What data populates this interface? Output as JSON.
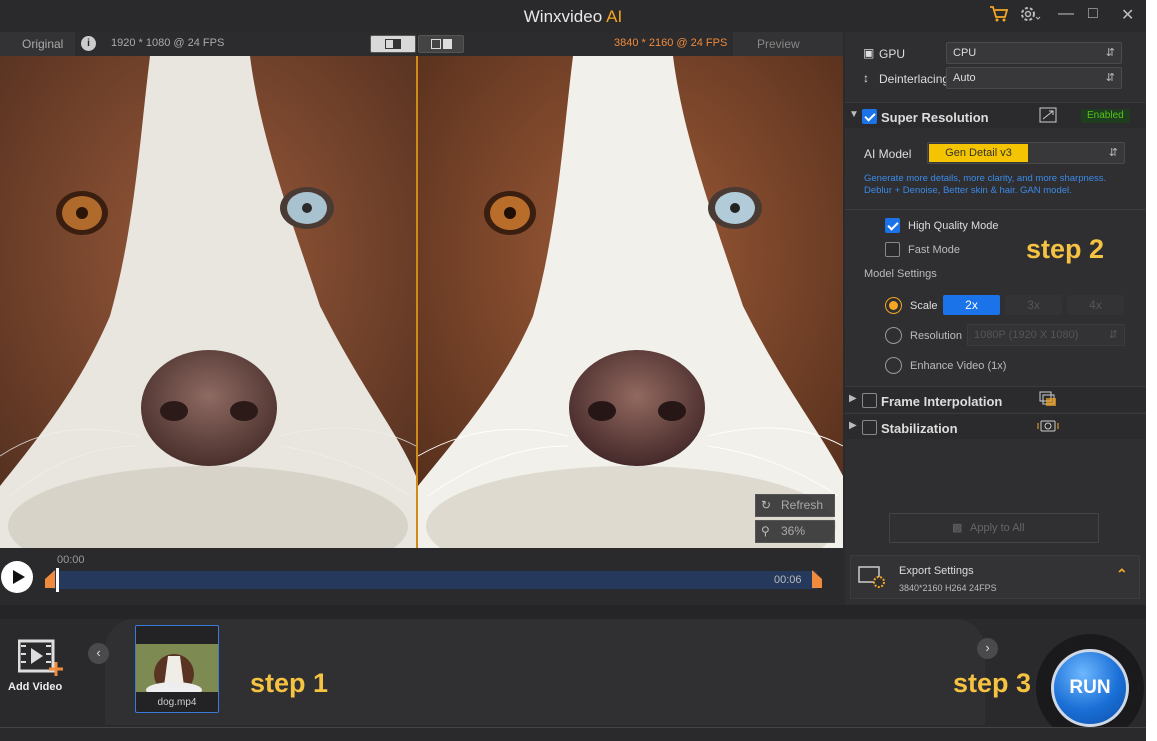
{
  "app": {
    "title": "Winxvideo",
    "title_ai": "AI",
    "colors": {
      "accent": "#f5a623",
      "blue": "#1a73e8",
      "enabled": "#52c41a"
    }
  },
  "titlebar": {
    "icons": [
      "cart-icon",
      "gear-icon",
      "minimize-icon",
      "maximize-icon",
      "close-icon"
    ]
  },
  "viewer": {
    "original_label": "Original",
    "info_icon": "i",
    "original_spec": "1920 * 1080 @ 24 FPS",
    "preview_spec": "3840 * 2160 @ 24 FPS",
    "preview_label": "Preview",
    "refresh": "Refresh",
    "zoom": "36%"
  },
  "timeline": {
    "current": "00:00",
    "end": "00:06"
  },
  "panel": {
    "gpu_label": "GPU",
    "gpu_value": "CPU",
    "deint_label": "Deinterlacing",
    "deint_value": "Auto",
    "super_res": {
      "label": "Super Resolution",
      "badge": "Enabled",
      "checked": true
    },
    "ai_model_label": "AI Model",
    "ai_model_value": "Gen Detail v3",
    "ai_desc1": "Generate more details, more clarity, and more sharpness.",
    "ai_desc2": "Deblur + Denoise, Better skin & hair. GAN model.",
    "hq_mode": "High Quality Mode",
    "fast_mode": "Fast Mode",
    "model_settings": "Model Settings",
    "scale_label": "Scale",
    "scale_opts": [
      "2x",
      "3x",
      "4x"
    ],
    "resolution_label": "Resolution",
    "resolution_value": "1080P (1920 X 1080)",
    "enhance_label": "Enhance Video (1x)",
    "frame_interp": "Frame Interpolation",
    "stabilization": "Stabilization",
    "apply_all": "Apply to All",
    "export_title": "Export Settings",
    "export_spec": "3840*2160  H264  24FPS"
  },
  "bottom": {
    "add_video": "Add Video",
    "file_name": "dog.mp4",
    "run": "RUN"
  },
  "steps": {
    "step1": "step 1",
    "step2": "step 2",
    "step3": "step 3"
  }
}
